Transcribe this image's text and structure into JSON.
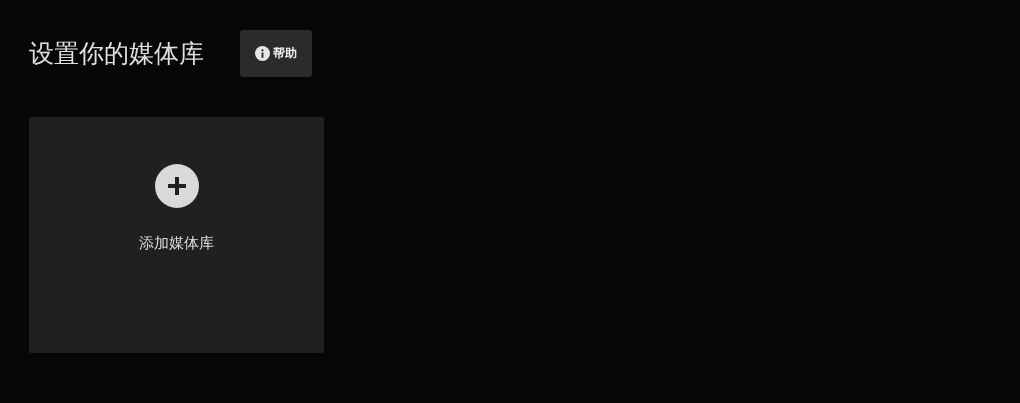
{
  "header": {
    "title": "设置你的媒体库",
    "help_button": "帮助"
  },
  "library_cards": [
    {
      "kind": "add",
      "label": "添加媒体库"
    }
  ]
}
